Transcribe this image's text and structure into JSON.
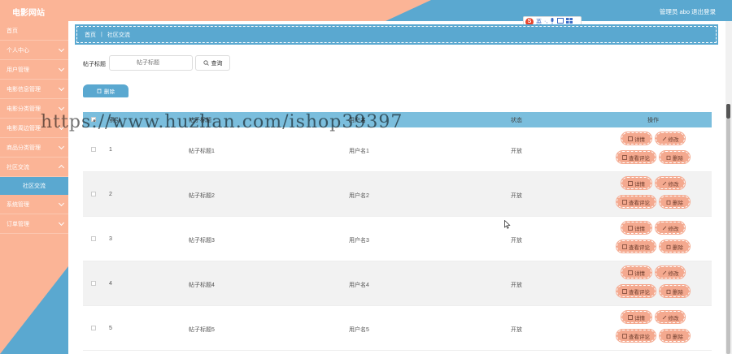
{
  "header": {
    "title": "电影网站",
    "user": "管理员 abo",
    "logout": "退出登录"
  },
  "ime": {
    "logo": "S",
    "labels": [
      "英",
      "·,",
      "🎤",
      "▦",
      "▦"
    ]
  },
  "sidebar": {
    "items": [
      {
        "label": "首页",
        "expandable": false
      },
      {
        "label": "个人中心",
        "expandable": true
      },
      {
        "label": "用户管理",
        "expandable": true
      },
      {
        "label": "电影信息管理",
        "expandable": true
      },
      {
        "label": "电影分类管理",
        "expandable": true
      },
      {
        "label": "电影周边管理",
        "expandable": true
      },
      {
        "label": "商品分类管理",
        "expandable": true
      },
      {
        "label": "社区交流",
        "expandable": true
      }
    ],
    "active_sub": "社区交流",
    "items_after": [
      {
        "label": "系统管理",
        "expandable": true
      },
      {
        "label": "订单管理",
        "expandable": true
      }
    ]
  },
  "breadcrumb": {
    "home": "首页",
    "sep": "|",
    "current": "社区交流"
  },
  "search": {
    "label": "帖子标题",
    "placeholder": "帖子标题",
    "button": "查询"
  },
  "bulk_delete": "删除",
  "table": {
    "columns": [
      "索引",
      "帖子标题",
      "用户名",
      "状态",
      "操作"
    ],
    "rows": [
      {
        "index": "1",
        "title": "帖子标题1",
        "user": "用户名1",
        "status": "开放"
      },
      {
        "index": "2",
        "title": "帖子标题2",
        "user": "用户名2",
        "status": "开放"
      },
      {
        "index": "3",
        "title": "帖子标题3",
        "user": "用户名3",
        "status": "开放"
      },
      {
        "index": "4",
        "title": "帖子标题4",
        "user": "用户名4",
        "status": "开放"
      },
      {
        "index": "5",
        "title": "帖子标题5",
        "user": "用户名5",
        "status": "开放"
      }
    ],
    "ops": {
      "detail": "详情",
      "edit": "修改",
      "comments": "查看评论",
      "delete": "删除"
    }
  },
  "watermark": "https://www.huzhan.com/ishop39397",
  "colors": {
    "peach": "#fbb496",
    "blue": "#5aa8d0",
    "button": "#f4a98f"
  }
}
